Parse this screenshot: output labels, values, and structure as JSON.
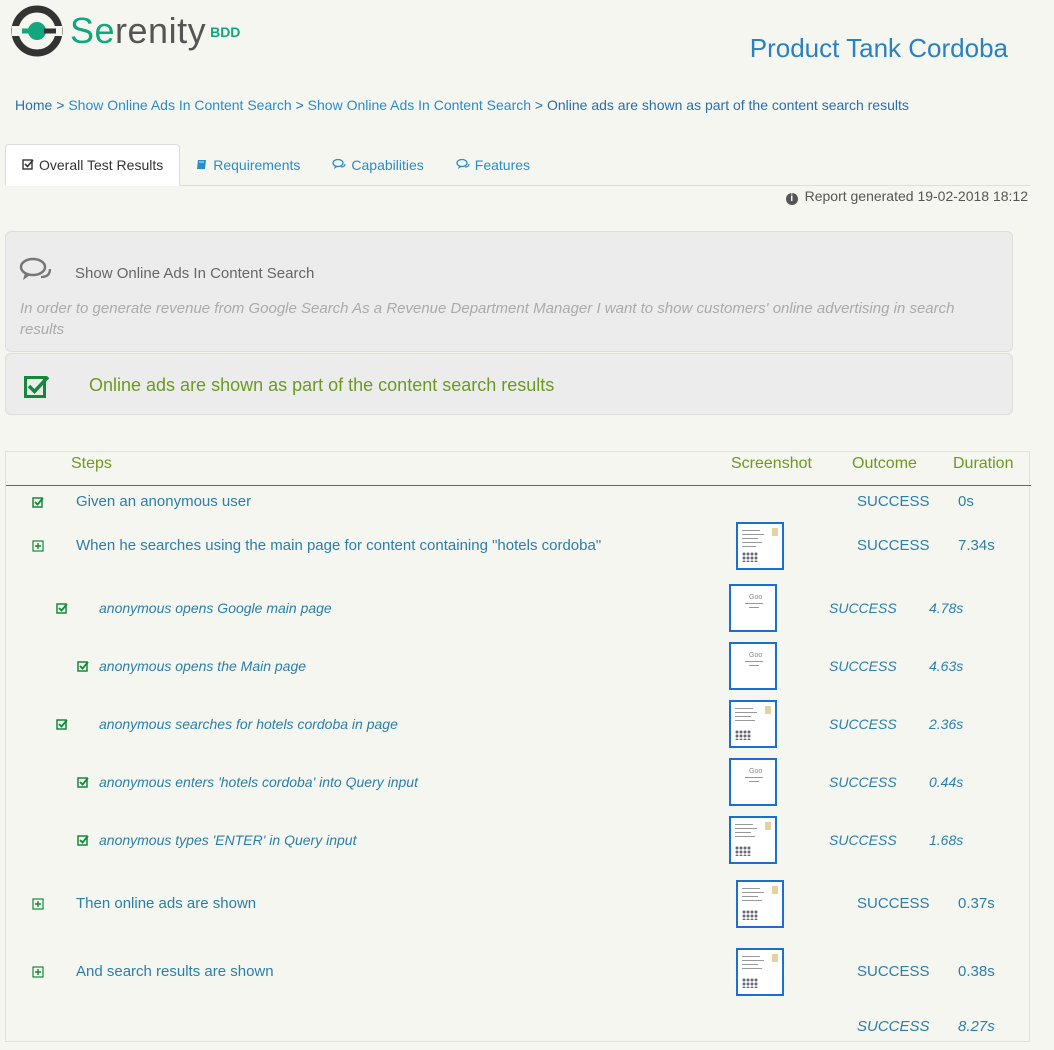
{
  "header": {
    "logo_text_accent": "Se",
    "logo_text_rest": "renity",
    "logo_badge": "BDD",
    "project_title": "Product Tank Cordoba"
  },
  "breadcrumb": {
    "home": "Home",
    "sep": ">",
    "items": [
      "Show Online Ads In Content Search",
      "Show Online Ads In Content Search",
      "Online ads are shown as part of the content search results"
    ]
  },
  "tabs": [
    {
      "label": "Overall Test Results",
      "icon": "check-square-icon"
    },
    {
      "label": "Requirements",
      "icon": "book-icon"
    },
    {
      "label": "Capabilities",
      "icon": "comments-icon"
    },
    {
      "label": "Features",
      "icon": "comments-icon"
    }
  ],
  "report": {
    "text": "Report generated 19-02-2018 18:12"
  },
  "feature": {
    "title": "Show Online Ads In Content Search",
    "description": "In order to generate revenue from Google Search As a Revenue Department Manager I want to show customers' online advertising in search results"
  },
  "scenario": {
    "title": "Online ads are shown as part of the content search results"
  },
  "table": {
    "headers": {
      "steps": "Steps",
      "screenshot": "Screenshot",
      "outcome": "Outcome",
      "duration": "Duration"
    },
    "rows": [
      {
        "desc": "Given an anonymous user",
        "outcome": "SUCCESS",
        "duration": "0s",
        "icon": "check-icon"
      },
      {
        "desc": "When he searches using the main page for content containing \"hotels cordoba\"",
        "outcome": "SUCCESS",
        "duration": "7.34s",
        "icon": "expand-icon"
      },
      {
        "desc": "anonymous opens Google main page",
        "outcome": "SUCCESS",
        "duration": "4.78s",
        "icon": "check-icon"
      },
      {
        "desc": "anonymous opens the Main page",
        "outcome": "SUCCESS",
        "duration": "4.63s",
        "icon": "check-icon"
      },
      {
        "desc": "anonymous searches for hotels cordoba in page",
        "outcome": "SUCCESS",
        "duration": "2.36s",
        "icon": "check-icon"
      },
      {
        "desc": "anonymous enters 'hotels cordoba' into Query input",
        "outcome": "SUCCESS",
        "duration": "0.44s",
        "icon": "check-icon"
      },
      {
        "desc": "anonymous types 'ENTER' in Query input",
        "outcome": "SUCCESS",
        "duration": "1.68s",
        "icon": "check-icon"
      },
      {
        "desc": "Then online ads are shown",
        "outcome": "SUCCESS",
        "duration": "0.37s",
        "icon": "expand-icon"
      },
      {
        "desc": "And search results are shown",
        "outcome": "SUCCESS",
        "duration": "0.38s",
        "icon": "expand-icon"
      }
    ],
    "total": {
      "outcome": "SUCCESS",
      "duration": "8.27s"
    }
  },
  "colors": {
    "accent": "#11a67e",
    "link": "#2a8cc8",
    "success": "#6b9a1f"
  }
}
